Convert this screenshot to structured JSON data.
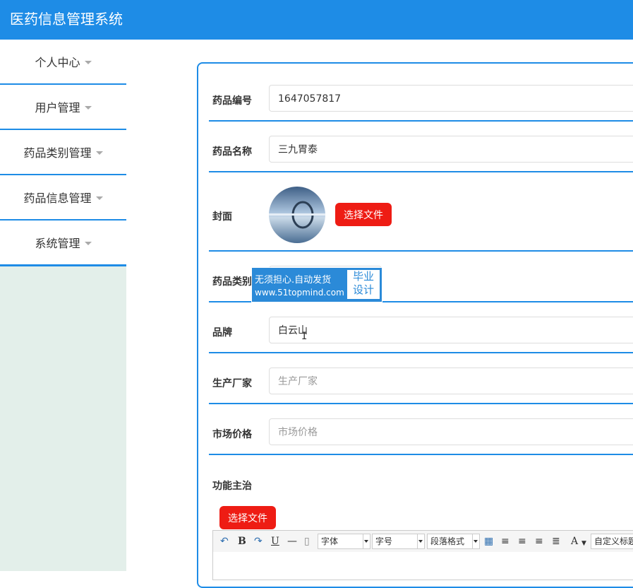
{
  "header": {
    "title": "医药信息管理系统",
    "bg_color": "#1e8ce6"
  },
  "sidebar": {
    "items": [
      {
        "label": "个人中心"
      },
      {
        "label": "用户管理"
      },
      {
        "label": "药品类别管理"
      },
      {
        "label": "药品信息管理"
      },
      {
        "label": "系统管理"
      }
    ]
  },
  "form": {
    "drug_code": {
      "label": "药品编号",
      "value": "1647057817"
    },
    "drug_name": {
      "label": "药品名称",
      "value": "三九胃泰"
    },
    "cover": {
      "label": "封面",
      "button": "选择文件"
    },
    "category": {
      "label": "药品类别"
    },
    "brand": {
      "label": "品牌",
      "value": "白云山"
    },
    "manufacturer": {
      "label": "生产厂家",
      "placeholder": "生产厂家"
    },
    "price": {
      "label": "市场价格",
      "placeholder": "市场价格"
    },
    "indications": {
      "label": "功能主治",
      "button": "选择文件"
    }
  },
  "watermark": {
    "left": "无须担心.自动发货",
    "url": "www.51topmind.com",
    "right_line1": "毕业",
    "right_line2": "设计"
  },
  "editor_toolbar": {
    "font_select": "字体",
    "size_select": "字号",
    "paragraph_select": "段落格式",
    "custom_title": "自定义标题",
    "bold": "B",
    "underline": "U",
    "font_color": "A"
  },
  "colors": {
    "accent": "#1e8ce6",
    "button_red": "#ee1c14",
    "sidebar_bg": "#e3efea"
  }
}
